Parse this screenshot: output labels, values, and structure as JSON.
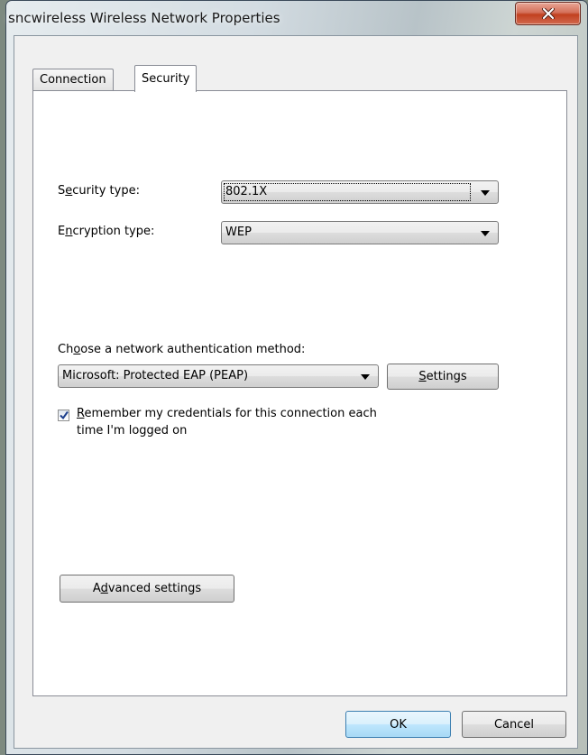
{
  "window": {
    "title": "sncwireless Wireless Network Properties"
  },
  "tabs": [
    {
      "label": "Connection",
      "active": false
    },
    {
      "label": "Security",
      "active": true
    }
  ],
  "security": {
    "security_type_label_pre": "S",
    "security_type_label_u": "e",
    "security_type_label_post": "curity type:",
    "security_type_value": "802.1X",
    "encryption_type_label_pre": "E",
    "encryption_type_label_u": "n",
    "encryption_type_label_post": "cryption type:",
    "encryption_type_value": "WEP",
    "auth_method_label_pre": "Ch",
    "auth_method_label_u": "o",
    "auth_method_label_post": "ose a network authentication method:",
    "auth_method_value": "Microsoft: Protected EAP (PEAP)",
    "settings_button_u": "S",
    "settings_button_post": "ettings",
    "remember_checked": true,
    "remember_line1_u": "R",
    "remember_line1_post": "emember my credentials for this connection each",
    "remember_line2": "time I'm logged on",
    "advanced_button_pre": "A",
    "advanced_button_u": "d",
    "advanced_button_post": "vanced settings"
  },
  "footer": {
    "ok_label": "OK",
    "cancel_label": "Cancel"
  },
  "colors": {
    "close_button": "#c1401f",
    "ok_button_border": "#3c7fb1"
  },
  "icons": {
    "close": "close-icon",
    "dropdown": "chevron-down-icon",
    "check": "checkmark-icon"
  }
}
